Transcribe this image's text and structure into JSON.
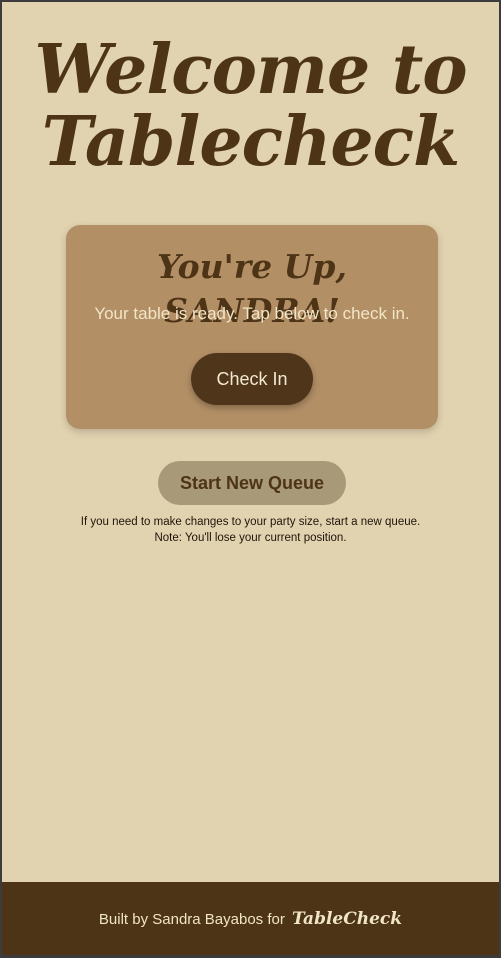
{
  "header": {
    "title_line1": "Welcome to",
    "title_line2": "Tablecheck"
  },
  "status_card": {
    "title": "You're Up, SANDRA!",
    "subtitle": "Your table is ready. Tap below to check in.",
    "checkin_label": "Check In"
  },
  "queue": {
    "new_queue_label": "Start New Queue",
    "note_line1": "If you need to make changes to your party size, start a new queue.",
    "note_line2": "Note: You'll lose your current position."
  },
  "footer": {
    "credit_text": "Built by Sandra Bayabos for",
    "brand": "TableCheck"
  },
  "colors": {
    "background": "#e2d3b0",
    "primary_brown": "#4e3416",
    "card": "#b38f66",
    "secondary_button": "#a89a78",
    "light_text": "#f1e5c7"
  }
}
